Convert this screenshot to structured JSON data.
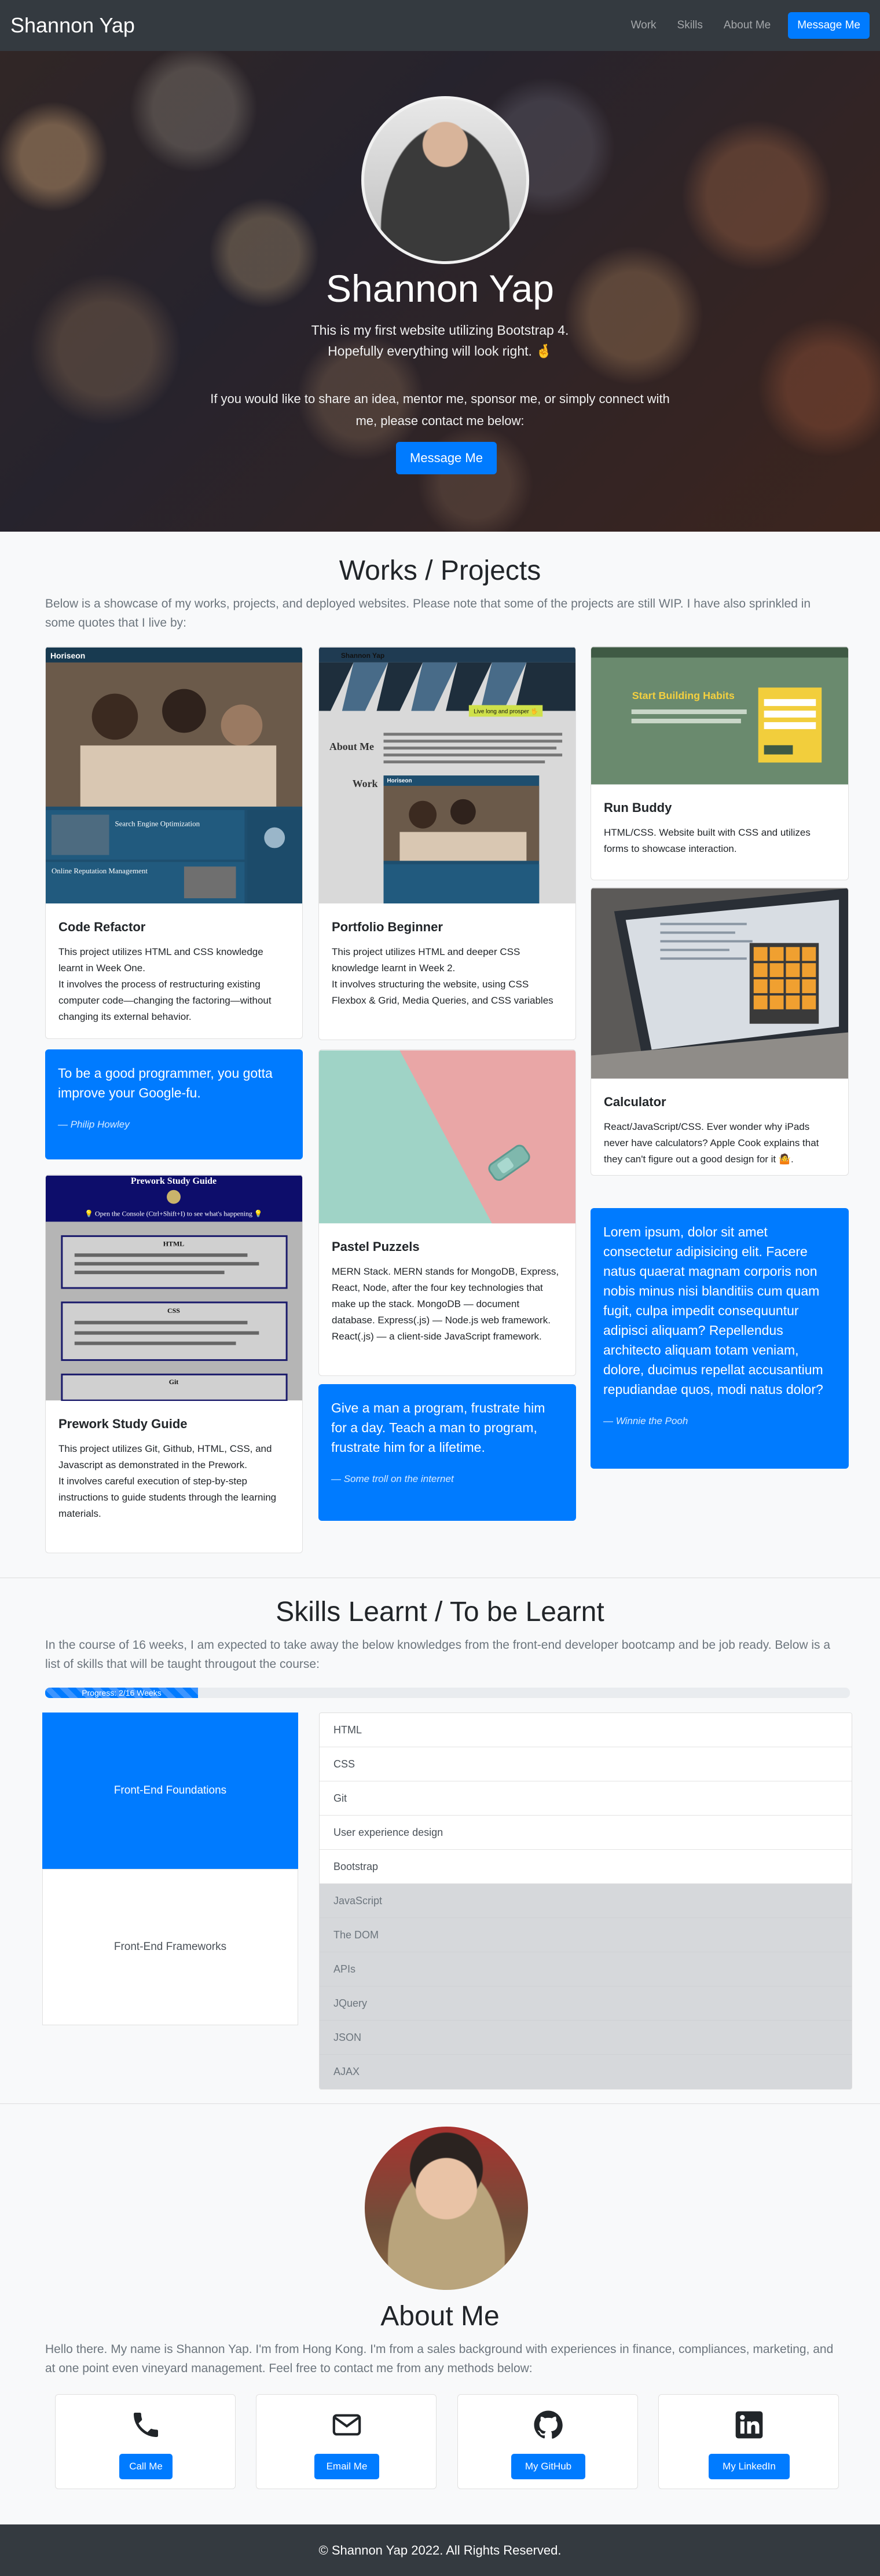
{
  "navbar": {
    "brand": "Shannon Yap",
    "links": [
      "Work",
      "Skills",
      "About Me"
    ],
    "cta": "Message Me"
  },
  "hero": {
    "name": "Shannon Yap",
    "tagline_1": "This is my first website utilizing Bootstrap 4.",
    "tagline_2": "Hopefully everything will look right. 🤞",
    "contact_text": "If you would like to share an idea, mentor me, sponsor me, or simply connect with me, please contact me below:",
    "cta": "Message Me"
  },
  "works": {
    "title": "Works / Projects",
    "lead": "Below is a showcase of my works, projects, and deployed websites. Please note that some of the projects are still WIP. I have also sprinkled in some quotes that I live by:",
    "cards": {
      "code_refactor": {
        "title": "Code Refactor",
        "text": "This project utilizes HTML and CSS knowledge learnt in Week One.\nIt involves the process of restructuring existing computer code—changing the factoring—without changing its external behavior."
      },
      "portfolio_beginner": {
        "title": "Portfolio Beginner",
        "text": "This project utilizes HTML and deeper CSS knowledge learnt in Week 2.\nIt involves structuring the website, using CSS Flexbox & Grid, Media Queries, and CSS variables"
      },
      "run_buddy": {
        "title": "Run Buddy",
        "text": "HTML/CSS. Website built with CSS and utilizes forms to showcase interaction."
      },
      "calculator": {
        "title": "Calculator",
        "text": "React/JavaScript/CSS. Ever wonder why iPads never have calculators? Apple Cook explains that they can't figure out a good design for it 🤷."
      },
      "pastel_puzzels": {
        "title": "Pastel Puzzels",
        "text": "MERN Stack. MERN stands for MongoDB, Express, React, Node, after the four key technologies that make up the stack. MongoDB — document database. Express(.js) — Node.js web framework. React(.js) — a client-side JavaScript framework."
      },
      "prework": {
        "title": "Prework Study Guide",
        "text": "This project utilizes Git, Github, HTML, CSS, and Javascript as demonstrated in the Prework.\nIt involves careful execution of step-by-step instructions to guide students through the learning materials."
      }
    },
    "quotes": {
      "q1": {
        "text": "To be a good programmer, you gotta improve your Google-fu.",
        "by": "—  Philip Howley"
      },
      "q2": {
        "text": "Give a man a program, frustrate him for a day. Teach a man to program, frustrate him for a lifetime.",
        "by": "—  Some troll on the internet"
      },
      "q3": {
        "text": "Lorem ipsum, dolor sit amet consectetur adipisicing elit. Facere natus quaerat magnam corporis non nobis minus nisi blanditiis cum quam fugit, culpa impedit consequuntur adipisci aliquam? Repellendus architecto aliquam totam veniam, dolore, ducimus repellat accusantium repudiandae quos, modi natus dolor?",
        "by": "—  Winnie the Pooh"
      }
    },
    "images": {
      "code_refactor_header": "Horiseon",
      "code_refactor_heading": "Search Engine Optimization",
      "code_refactor_heading_2": "Online Reputation Management",
      "portfolio_header": "Shannon Yap",
      "portfolio_about": "About Me",
      "portfolio_work": "Work",
      "portfolio_mini_header": "Horiseon",
      "portfolio_banner": "Live long and prosper 🖖",
      "run_buddy_title": "Start Building Habits",
      "prework_title": "Prework Study Guide",
      "prework_console": "💡 Open the Console (Ctrl+Shift+I) to see what's happening 💡",
      "prework_s1": "HTML",
      "prework_s2": "CSS",
      "prework_s3": "Git"
    }
  },
  "skills": {
    "title": "Skills Learnt / To be Learnt",
    "lead": "In the course of 16 weeks, I am expected to take away the below knowledges from the front-end developer bootcamp and be job ready. Below is a list of skills that will be taught througout the course:",
    "progress_label": "Progress: 2/16 Weeks",
    "progress_fraction": 0.19,
    "tabs": [
      "Front-End Foundations",
      "Front-End Frameworks"
    ],
    "items": [
      "HTML",
      "CSS",
      "Git",
      "User experience design",
      "Bootstrap",
      "JavaScript",
      "The DOM",
      "APIs",
      "JQuery",
      "JSON",
      "AJAX"
    ]
  },
  "about": {
    "title": "About Me",
    "text": "Hello there. My name is Shannon Yap. I'm from Hong Kong. I'm from a sales background with experiences in finance, compliances, marketing, and at one point even vineyard management. Feel free to contact me from any methods below:",
    "contacts": [
      {
        "icon": "phone-icon",
        "label": "Call Me"
      },
      {
        "icon": "envelope-icon",
        "label": "Email Me"
      },
      {
        "icon": "github-icon",
        "label": "My GitHub"
      },
      {
        "icon": "linkedin-icon",
        "label": "My LinkedIn"
      }
    ]
  },
  "footer": {
    "text": "© Shannon Yap 2022. All Rights Reserved."
  },
  "colors": {
    "primary": "#007bff",
    "navbar": "#343a40",
    "page": "#f8f9fa"
  }
}
